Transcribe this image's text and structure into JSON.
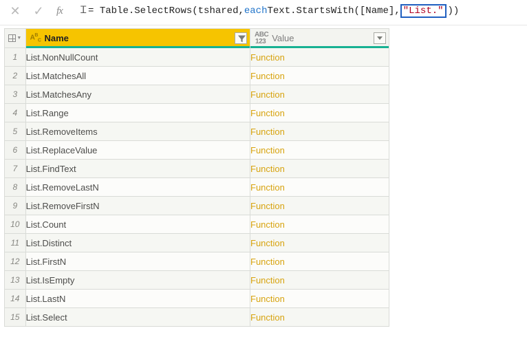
{
  "formula_bar": {
    "fx_label": "fx",
    "prefix": "= Table.SelectRows(tshared, ",
    "kw_each": "each",
    "mid": " Text.StartsWith([Name], ",
    "highlighted_str": "\"List.\"",
    "suffix": "))"
  },
  "columns": {
    "name": {
      "type_badge_top": "A",
      "type_badge_sub": "B",
      "type_badge_sub2": "C",
      "label": "Name"
    },
    "value": {
      "type_badge_top": "ABC",
      "type_badge_sub": "123",
      "label": "Value"
    }
  },
  "rows": [
    {
      "n": "1",
      "name": "List.NonNullCount",
      "value": "Function"
    },
    {
      "n": "2",
      "name": "List.MatchesAll",
      "value": "Function"
    },
    {
      "n": "3",
      "name": "List.MatchesAny",
      "value": "Function"
    },
    {
      "n": "4",
      "name": "List.Range",
      "value": "Function"
    },
    {
      "n": "5",
      "name": "List.RemoveItems",
      "value": "Function"
    },
    {
      "n": "6",
      "name": "List.ReplaceValue",
      "value": "Function"
    },
    {
      "n": "7",
      "name": "List.FindText",
      "value": "Function"
    },
    {
      "n": "8",
      "name": "List.RemoveLastN",
      "value": "Function"
    },
    {
      "n": "9",
      "name": "List.RemoveFirstN",
      "value": "Function"
    },
    {
      "n": "10",
      "name": "List.Count",
      "value": "Function"
    },
    {
      "n": "11",
      "name": "List.Distinct",
      "value": "Function"
    },
    {
      "n": "12",
      "name": "List.FirstN",
      "value": "Function"
    },
    {
      "n": "13",
      "name": "List.IsEmpty",
      "value": "Function"
    },
    {
      "n": "14",
      "name": "List.LastN",
      "value": "Function"
    },
    {
      "n": "15",
      "name": "List.Select",
      "value": "Function"
    }
  ]
}
